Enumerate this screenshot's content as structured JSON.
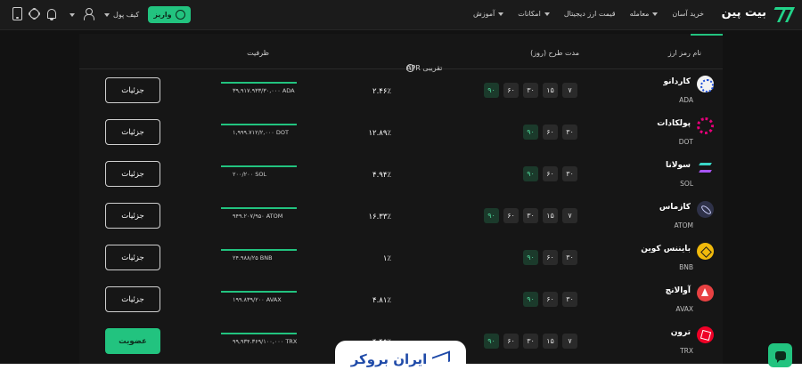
{
  "header": {
    "logo_text": "بیت پین",
    "nav": [
      {
        "label": "خرید آسان",
        "has_caret": false
      },
      {
        "label": "معامله",
        "has_caret": true
      },
      {
        "label": "قیمت ارز دیجیتال",
        "has_caret": false
      },
      {
        "label": "امکانات",
        "has_caret": true
      },
      {
        "label": "آموزش",
        "has_caret": true
      }
    ],
    "deposit_label": "واریز",
    "wallet_label": "کیف پول"
  },
  "table": {
    "headers": {
      "name": "نام رمز ارز",
      "term": "مدت طرح (روز)",
      "apr": "APR تقریبی",
      "capacity": "ظرفیت"
    },
    "rows": [
      {
        "name": "کاردانو",
        "symbol": "ADA",
        "logo": "ada-logo",
        "terms": [
          "۷",
          "۱۵",
          "۳۰",
          "۶۰",
          "۹۰"
        ],
        "active_term": "۹۰",
        "apr": "۲.۴۶٪",
        "capacity": "۳۹,۹۱۷.۹۳۳/۳۰,۰۰۰ ADA",
        "fill": 1.0,
        "action": "جزئیات",
        "action_type": "detail"
      },
      {
        "name": "پولکادات",
        "symbol": "DOT",
        "logo": "dot-logo",
        "terms": [
          "۳۰",
          "۶۰",
          "۹۰"
        ],
        "active_term": "۹۰",
        "apr": "۱۲.۸۹٪",
        "capacity": "۱,۹۹۹.۷۱۲/۲,۰۰۰ DOT",
        "fill": 1.0,
        "action": "جزئیات",
        "action_type": "detail"
      },
      {
        "name": "سولانا",
        "symbol": "SOL",
        "logo": "sol-logo",
        "terms": [
          "۳۰",
          "۶۰",
          "۹۰"
        ],
        "active_term": "۹۰",
        "apr": "۴.۹۴٪",
        "capacity": "۲۰۰/۲۰۰ SOL",
        "fill": 1.0,
        "action": "جزئیات",
        "action_type": "detail"
      },
      {
        "name": "کازماس",
        "symbol": "ATOM",
        "logo": "atom-logo",
        "terms": [
          "۷",
          "۱۵",
          "۳۰",
          "۶۰",
          "۹۰"
        ],
        "active_term": "۹۰",
        "apr": "۱۶.۳۳٪",
        "capacity": "۹۴۹.۲۰۷/۹۵۰ ATOM",
        "fill": 1.0,
        "action": "جزئیات",
        "action_type": "detail"
      },
      {
        "name": "بایننس کوین",
        "symbol": "BNB",
        "logo": "bnb-logo",
        "terms": [
          "۳۰",
          "۶۰",
          "۹۰"
        ],
        "active_term": "۹۰",
        "apr": "۱٪",
        "capacity": "۲۴.۹۸۸/۲۵ BNB",
        "fill": 1.0,
        "action": "جزئیات",
        "action_type": "detail"
      },
      {
        "name": "آوالانچ",
        "symbol": "AVAX",
        "logo": "avax-logo",
        "terms": [
          "۳۰",
          "۶۰",
          "۹۰"
        ],
        "active_term": "۹۰",
        "apr": "۴.۸۱٪",
        "capacity": "۱۹۹.۸۳۹/۲۰۰ AVAX",
        "fill": 1.0,
        "action": "جزئیات",
        "action_type": "detail"
      },
      {
        "name": "ترون",
        "symbol": "TRX",
        "logo": "trx-logo",
        "terms": [
          "۷",
          "۱۵",
          "۳۰",
          "۶۰",
          "۹۰"
        ],
        "active_term": "۹۰",
        "apr": "۴.۴۵٪",
        "capacity": "۹۹,۹۳۴.۳۶۹/۱۰۰,۰۰۰ TRX",
        "fill": 1.0,
        "action": "عضویت",
        "action_type": "join"
      }
    ]
  },
  "watermark": "ایران بروکر",
  "colors": {
    "accent": "#22c37f",
    "background": "#121212",
    "panel": "#161616"
  },
  "icons": {
    "info": "i"
  }
}
